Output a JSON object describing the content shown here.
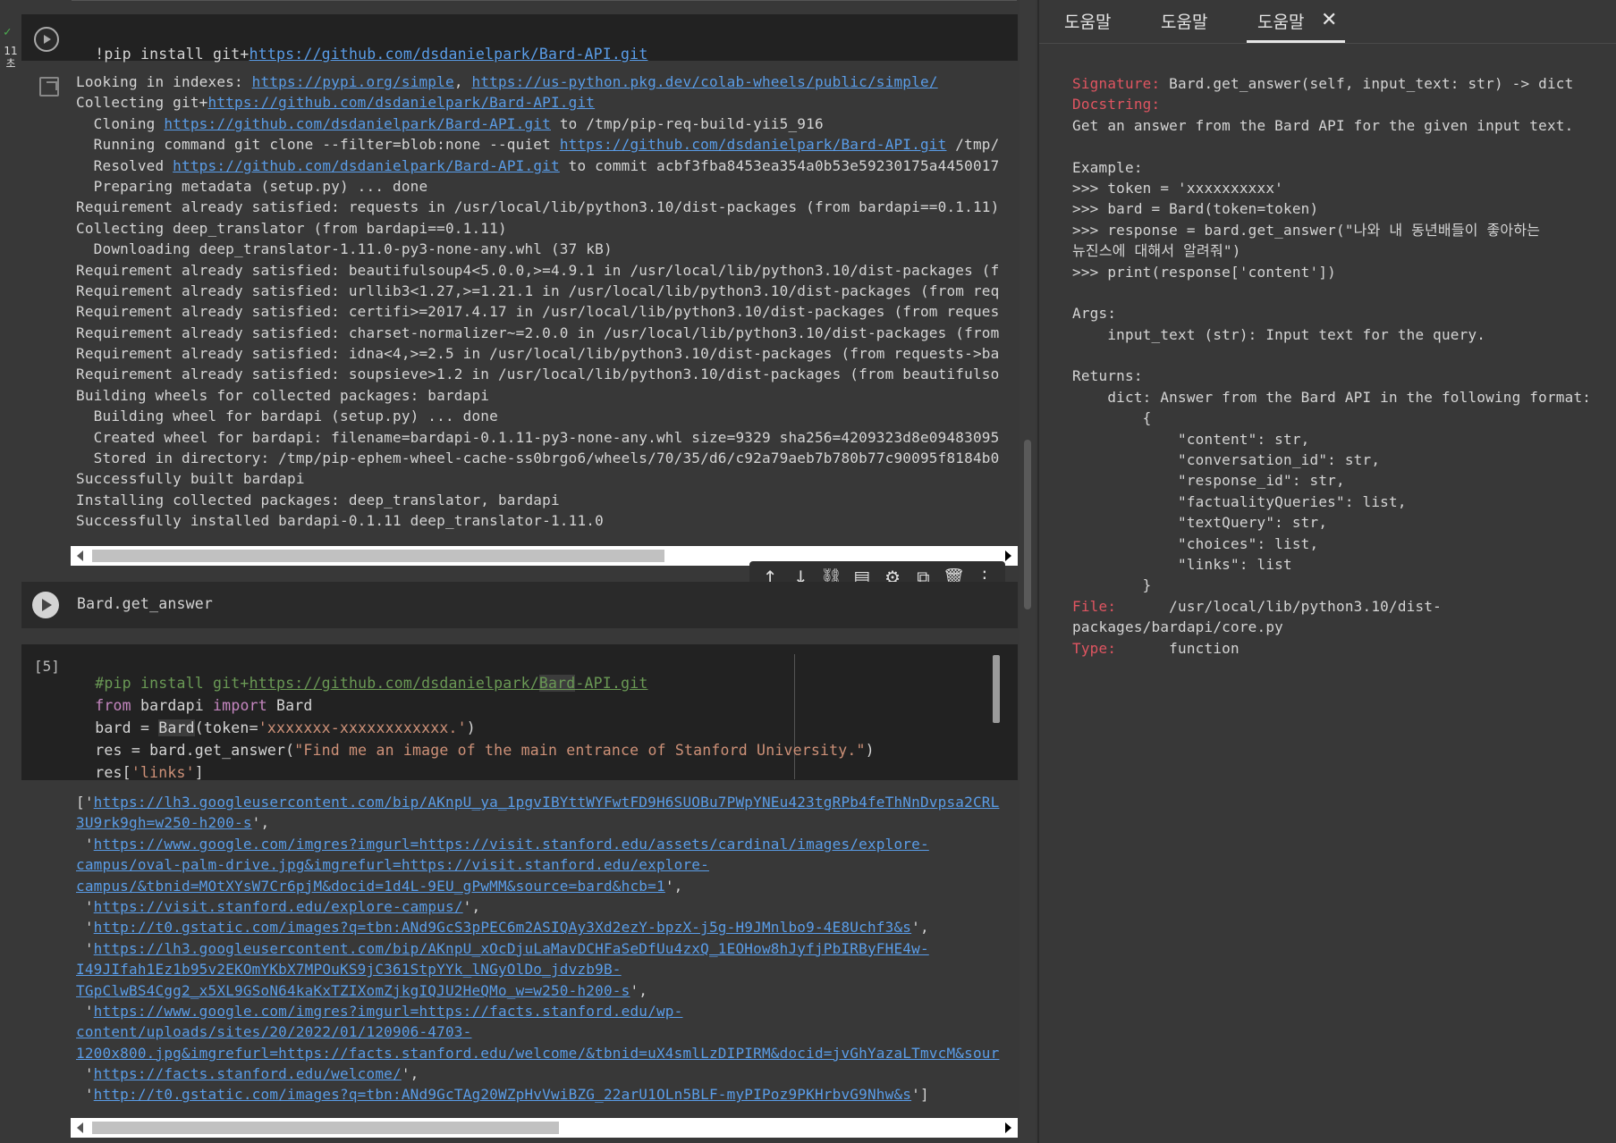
{
  "gutter": {
    "check": "✓",
    "time": "11\n초"
  },
  "cell1": {
    "code": "!pip install git+https://github.com/dsdanielpark/Bard-API.git",
    "code_prefix": "!pip install git+",
    "code_link": "https://github.com/dsdanielpark/Bard-API.git",
    "output": [
      [
        "Looking in indexes: ",
        "https://pypi.org/simple",
        ", ",
        "https://us-python.pkg.dev/colab-wheels/public/simple/"
      ],
      [
        "Collecting git+",
        "https://github.com/dsdanielpark/Bard-API.git"
      ],
      [
        "  Cloning ",
        "https://github.com/dsdanielpark/Bard-API.git",
        " to /tmp/pip-req-build-yii5_916"
      ],
      [
        "  Running command git clone --filter=blob:none --quiet ",
        "https://github.com/dsdanielpark/Bard-API.git",
        " /tmp/"
      ],
      [
        "  Resolved ",
        "https://github.com/dsdanielpark/Bard-API.git",
        " to commit acbf3fba8453ea354a0b53e59230175a4450017"
      ],
      [
        "  Preparing metadata (setup.py) ... done"
      ],
      [
        "Requirement already satisfied: requests in /usr/local/lib/python3.10/dist-packages (from bardapi==0.1.11)"
      ],
      [
        "Collecting deep_translator (from bardapi==0.1.11)"
      ],
      [
        "  Downloading deep_translator-1.11.0-py3-none-any.whl (37 kB)"
      ],
      [
        "Requirement already satisfied: beautifulsoup4<5.0.0,>=4.9.1 in /usr/local/lib/python3.10/dist-packages (f"
      ],
      [
        "Requirement already satisfied: urllib3<1.27,>=1.21.1 in /usr/local/lib/python3.10/dist-packages (from req"
      ],
      [
        "Requirement already satisfied: certifi>=2017.4.17 in /usr/local/lib/python3.10/dist-packages (from reques"
      ],
      [
        "Requirement already satisfied: charset-normalizer~=2.0.0 in /usr/local/lib/python3.10/dist-packages (from"
      ],
      [
        "Requirement already satisfied: idna<4,>=2.5 in /usr/local/lib/python3.10/dist-packages (from requests->ba"
      ],
      [
        "Requirement already satisfied: soupsieve>1.2 in /usr/local/lib/python3.10/dist-packages (from beautifulso"
      ],
      [
        "Building wheels for collected packages: bardapi"
      ],
      [
        "  Building wheel for bardapi (setup.py) ... done"
      ],
      [
        "  Created wheel for bardapi: filename=bardapi-0.1.11-py3-none-any.whl size=9329 sha256=4209323d8e09483095"
      ],
      [
        "  Stored in directory: /tmp/pip-ephem-wheel-cache-ss0brgo6/wheels/70/35/d6/c92a79aeb7b780b77c90095f8184b0"
      ],
      [
        "Successfully built bardapi"
      ],
      [
        "Installing collected packages: deep_translator, bardapi"
      ],
      [
        "Successfully installed bardapi-0.1.11 deep_translator-1.11.0"
      ]
    ]
  },
  "cell2": {
    "code": "Bard.get_answer"
  },
  "cell3": {
    "prompt": "[5]",
    "line1_prefix": "#pip install git+",
    "line1_link_a": "https://github.com/dsdanielpark/",
    "line1_link_b": "Bard",
    "line1_link_c": "-API.git",
    "line2_from": "from",
    "line2_mod": " bardapi ",
    "line2_import": "import",
    "line2_name": " Bard",
    "line3_pre": "bard = ",
    "line3_cls": "Bard",
    "line3_arg": "(token=",
    "line3_str": "'xxxxxxx-xxxxxxxxxxxx.'",
    "line3_end": ")",
    "line4_pre": "res = bard.get_answer(",
    "line4_str": "\"Find me an image of the main entrance of Stanford University.\"",
    "line4_end": ")",
    "line5_pre": "res[",
    "line5_str": "'links'",
    "line5_end": "]",
    "output": [
      [
        "['",
        "https://lh3.googleusercontent.com/bip/AKnpU_ya_1pgvIBYttWYFwtFD9H6SUOBu7PWpYNEu423tgRPb4feThNnDvpsa2CRL",
        ""
      ],
      [
        "",
        "3U9rk9gh=w250-h200-s",
        "',"
      ],
      [
        " '",
        "https://www.google.com/imgres?imgurl=https://visit.stanford.edu/assets/cardinal/images/explore-",
        ""
      ],
      [
        "",
        "campus/oval-palm-drive.jpg&imgrefurl=https://visit.stanford.edu/explore-",
        ""
      ],
      [
        "",
        "campus/&tbnid=MOtXYsW7Cr6pjM&docid=1d4L-9EU_gPwMM&source=bard&hcb=1",
        "',"
      ],
      [
        " '",
        "https://visit.stanford.edu/explore-campus/",
        "',"
      ],
      [
        " '",
        "http://t0.gstatic.com/images?q=tbn:ANd9GcS3pPEC6m2ASIQAy3Xd2ezY-bpzX-j5g-H9JMnlbo9-4E8Uchf3&s",
        "',"
      ],
      [
        " '",
        "https://lh3.googleusercontent.com/bip/AKnpU_xOcDjuLaMavDCHFaSeDfUu4zxQ_1EOHow8hJyfjPbIRByFHE4w-",
        ""
      ],
      [
        "",
        "I49JIfah1Ez1b95v2EKOmYKbX7MPOuKS9jC361StpYYk_lNGyOlDo_jdvzb9B-",
        ""
      ],
      [
        "",
        "TGpClwBS4Cgg2_x5XL9GSoN64kaKxTZIXomZjkgIQJU2HeQMo_w=w250-h200-s",
        "',"
      ],
      [
        " '",
        "https://www.google.com/imgres?imgurl=https://facts.stanford.edu/wp-",
        ""
      ],
      [
        "",
        "content/uploads/sites/20/2022/01/120906-4703-",
        ""
      ],
      [
        "",
        "1200x800.jpg&imgrefurl=https://facts.stanford.edu/welcome/&tbnid=uX4smlLzDIPIRM&docid=jvGhYazaLTmvcM&sour",
        ""
      ],
      [
        " '",
        "https://facts.stanford.edu/welcome/",
        "',"
      ],
      [
        " '",
        "http://t0.gstatic.com/images?q=tbn:ANd9GcTAg20WZpHvVwiBZG_22arU1OLn5BLF-myPIPoz9PKHrbvG9Nhw&s",
        "']"
      ]
    ]
  },
  "help": {
    "tabs": [
      "도움말",
      "도움말",
      "도움말"
    ],
    "close": "✕",
    "lines": [
      [
        "Signature:",
        " Bard.get_answer(self, input_text: str) -> dict"
      ],
      [
        "Docstring:",
        ""
      ],
      [
        "",
        "Get an answer from the Bard API for the given input text."
      ],
      [
        "",
        ""
      ],
      [
        "",
        "Example:"
      ],
      [
        "",
        ">>> token = 'xxxxxxxxxx'"
      ],
      [
        "",
        ">>> bard = Bard(token=token)"
      ],
      [
        "",
        ">>> response = bard.get_answer(\"나와 내 동년배들이 좋아하는"
      ],
      [
        "",
        "뉴진스에 대해서 알려줘\")"
      ],
      [
        "",
        ">>> print(response['content'])"
      ],
      [
        "",
        ""
      ],
      [
        "",
        "Args:"
      ],
      [
        "",
        "    input_text (str): Input text for the query."
      ],
      [
        "",
        ""
      ],
      [
        "",
        "Returns:"
      ],
      [
        "",
        "    dict: Answer from the Bard API in the following format:"
      ],
      [
        "",
        "        {"
      ],
      [
        "",
        "            \"content\": str,"
      ],
      [
        "",
        "            \"conversation_id\": str,"
      ],
      [
        "",
        "            \"response_id\": str,"
      ],
      [
        "",
        "            \"factualityQueries\": list,"
      ],
      [
        "",
        "            \"textQuery\": str,"
      ],
      [
        "",
        "            \"choices\": list,"
      ],
      [
        "",
        "            \"links\": list"
      ],
      [
        "",
        "        }"
      ],
      [
        "File:",
        "      /usr/local/lib/python3.10/dist-"
      ],
      [
        "",
        "packages/bardapi/core.py"
      ],
      [
        "Type:",
        "      function"
      ]
    ]
  },
  "toolbar": [
    "move-up",
    "move-down",
    "link",
    "comment",
    "settings",
    "mirror",
    "delete",
    "more"
  ]
}
